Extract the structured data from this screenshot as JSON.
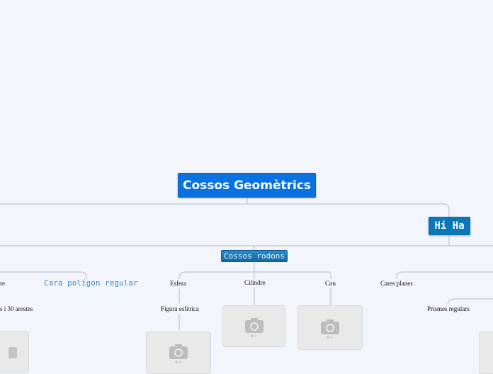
{
  "map": {
    "root": "Cossos Geomètrics",
    "branch_right": "Hi Ha",
    "branch_round": "Cossos rodons",
    "cara": "Cara polígon regular",
    "partial_re": "re",
    "partial_arestes": "s i 30 arestes",
    "esfera": "Esfera",
    "figura": "Figura esfèrica",
    "cilindre": "Cilindre",
    "con": "Con",
    "cares": "Cares planes",
    "prismes": "Prismes regulars"
  },
  "icons": {
    "photo_placeholder": "camera-icon"
  },
  "colors": {
    "root": "#0a72e0",
    "branch": "#0a76b5",
    "connector": "#b7bcc8"
  }
}
